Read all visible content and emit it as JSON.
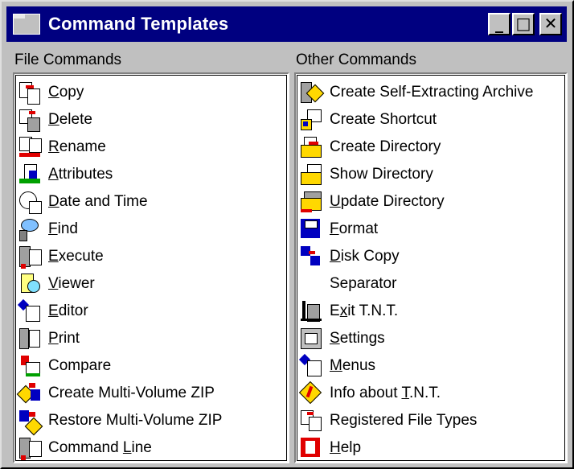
{
  "window": {
    "title": "Command Templates",
    "minimize_glyph": "_",
    "maximize_glyph": "□",
    "close_glyph": "✕"
  },
  "file_commands": {
    "label": "File Commands",
    "items": [
      {
        "label": "Copy",
        "accel": 0,
        "icon": "copy-icon"
      },
      {
        "label": "Delete",
        "accel": 0,
        "icon": "delete-icon"
      },
      {
        "label": "Rename",
        "accel": 0,
        "icon": "rename-icon"
      },
      {
        "label": "Attributes",
        "accel": 0,
        "icon": "attributes-icon"
      },
      {
        "label": "Date and Time",
        "accel": 0,
        "icon": "clock-icon"
      },
      {
        "label": "Find",
        "accel": 0,
        "icon": "find-icon"
      },
      {
        "label": "Execute",
        "accel": 0,
        "icon": "execute-icon"
      },
      {
        "label": "Viewer",
        "accel": 0,
        "icon": "viewer-icon"
      },
      {
        "label": "Editor",
        "accel": 0,
        "icon": "editor-icon"
      },
      {
        "label": "Print",
        "accel": 0,
        "icon": "printer-icon"
      },
      {
        "label": "Compare",
        "accel": -1,
        "icon": "compare-icon"
      },
      {
        "label": "Create Multi-Volume ZIP",
        "accel": -1,
        "icon": "zip-create-icon"
      },
      {
        "label": "Restore Multi-Volume ZIP",
        "accel": -1,
        "icon": "zip-restore-icon"
      },
      {
        "label": "Command Line",
        "accel": 8,
        "icon": "command-line-icon"
      }
    ]
  },
  "other_commands": {
    "label": "Other Commands",
    "items": [
      {
        "label": "Create Self-Extracting Archive",
        "accel": -1,
        "icon": "self-extract-icon"
      },
      {
        "label": "Create Shortcut",
        "accel": -1,
        "icon": "shortcut-icon"
      },
      {
        "label": "Create Directory",
        "accel": -1,
        "icon": "create-directory-icon"
      },
      {
        "label": "Show Directory",
        "accel": -1,
        "icon": "show-directory-icon"
      },
      {
        "label": "Update Directory",
        "accel": 0,
        "icon": "update-directory-icon"
      },
      {
        "label": "Format",
        "accel": 0,
        "icon": "floppy-disk-icon"
      },
      {
        "label": "Disk Copy",
        "accel": 0,
        "icon": "disk-copy-icon"
      },
      {
        "label": "Separator",
        "accel": -1,
        "icon": ""
      },
      {
        "label": "Exit T.N.T.",
        "accel": 1,
        "icon": "exit-icon"
      },
      {
        "label": "Settings",
        "accel": 0,
        "icon": "settings-icon"
      },
      {
        "label": "Menus",
        "accel": 0,
        "icon": "menus-icon"
      },
      {
        "label": "Info about T.N.T.",
        "accel": 11,
        "icon": "info-icon"
      },
      {
        "label": "Registered File Types",
        "accel": -1,
        "icon": "file-types-icon"
      },
      {
        "label": "Help",
        "accel": 0,
        "icon": "help-icon"
      }
    ]
  }
}
